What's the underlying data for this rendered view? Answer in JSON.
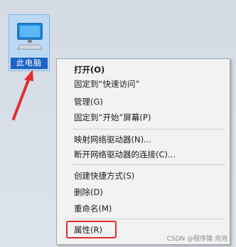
{
  "desktop": {
    "icon_label": "此电脑",
    "icon_name": "computer-icon"
  },
  "menu": {
    "items": [
      {
        "label": "打开(O)",
        "bold": true
      },
      {
        "label": "固定到“快速访问”"
      },
      {
        "label": "管理(G)"
      },
      {
        "label": "固定到“开始”屏幕(P)"
      },
      {
        "label": "映射网络驱动器(N)..."
      },
      {
        "label": "断开网络驱动器的连接(C)..."
      },
      {
        "label": "创建快捷方式(S)"
      },
      {
        "label": "删除(D)"
      },
      {
        "label": "重命名(M)"
      },
      {
        "label": "属性(R)"
      }
    ]
  },
  "annotation": {
    "color": "#e32d2d"
  },
  "watermark": "CSDN @程序猿 泡泡"
}
